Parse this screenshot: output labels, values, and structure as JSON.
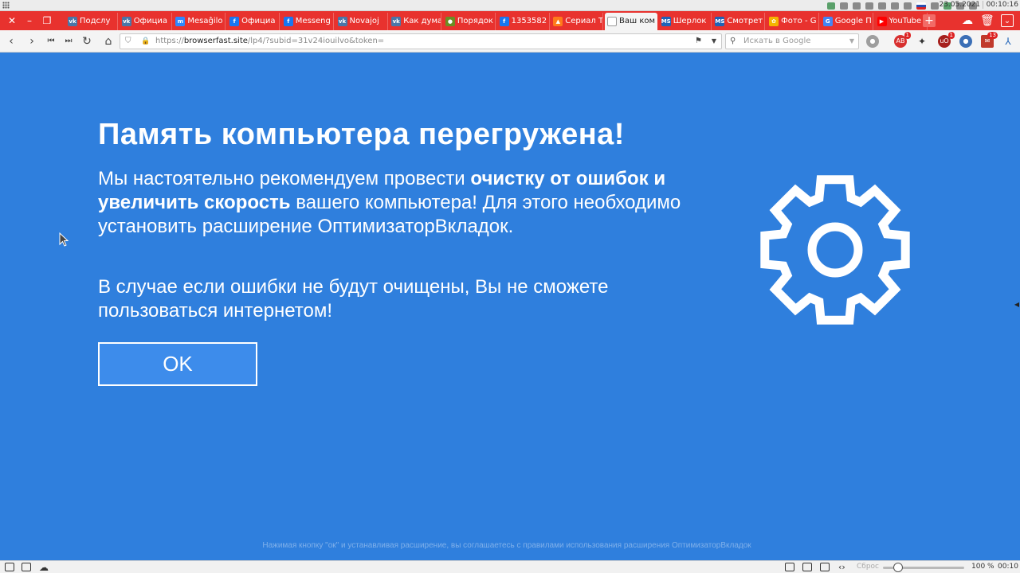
{
  "system": {
    "date": "23.05.2021",
    "time": "00:10:16"
  },
  "tabs": [
    {
      "label": "Подслу",
      "icon": "vk-icon",
      "color": "#4a76a8",
      "glyph": "vk"
    },
    {
      "label": "Официа",
      "icon": "vk-icon",
      "color": "#4a76a8",
      "glyph": "vk"
    },
    {
      "label": "Mesaĝilo",
      "icon": "messenger-icon",
      "color": "#2d88ff",
      "glyph": "m"
    },
    {
      "label": "Официа",
      "icon": "facebook-icon",
      "color": "#1877f2",
      "glyph": "f"
    },
    {
      "label": "Messeng",
      "icon": "facebook-icon",
      "color": "#1877f2",
      "glyph": "f"
    },
    {
      "label": "Novajoj",
      "icon": "vk-icon",
      "color": "#4a76a8",
      "glyph": "vk"
    },
    {
      "label": "Как дума",
      "icon": "vk-icon",
      "color": "#4a76a8",
      "glyph": "vk"
    },
    {
      "label": "Порядок",
      "icon": "globe-icon",
      "color": "#6b8e23",
      "glyph": "●"
    },
    {
      "label": "1353582",
      "icon": "facebook-icon",
      "color": "#1877f2",
      "glyph": "f"
    },
    {
      "label": "Сериал Т",
      "icon": "flame-icon",
      "color": "#ff7a1a",
      "glyph": "▲"
    },
    {
      "label": "Ваш ком",
      "icon": "page-icon",
      "color": "#ffffff",
      "glyph": "",
      "active": true
    },
    {
      "label": "Шерлок",
      "icon": "ms-icon",
      "color": "#1e63b8",
      "glyph": "MS"
    },
    {
      "label": "Смотрет",
      "icon": "ms-icon",
      "color": "#1e63b8",
      "glyph": "MS"
    },
    {
      "label": "Фото - G",
      "icon": "google-photos-icon",
      "color": "#f4b400",
      "glyph": "✿"
    },
    {
      "label": "Google П",
      "icon": "google-translate-icon",
      "color": "#4285f4",
      "glyph": "G"
    },
    {
      "label": "YouTube",
      "icon": "youtube-icon",
      "color": "#ff0000",
      "glyph": "▶"
    }
  ],
  "nav": {
    "url_scheme": "https://",
    "url_host": "browserfast.site",
    "url_path": "/lp4/?subid=31v24iouilvo&token=",
    "search_placeholder": "Искать в Google"
  },
  "extensions": {
    "badge1": "1",
    "badge2": "1",
    "badge3": "13"
  },
  "page": {
    "headline": "Память компьютера перегружена!",
    "p1_pre": "Мы настоятельно рекомендуем провести ",
    "p1_bold1": "очистку от ошибок и увеличить скорость",
    "p1_post": " вашего компьютера! Для этого необходимо установить расширение ОптимизаторВкладок.",
    "p2": "В случае если ошибки не будут очищены, Вы не сможете пользоваться интернетом!",
    "ok_label": "OK",
    "footnote": "Нажимая кнопку \"ок\" и устанавливая расширение, вы соглашаетесь с правилами использования расширения ОптимизаторВкладок"
  },
  "status": {
    "reset_label": "Сброс",
    "zoom": "100 %",
    "time": "00:10"
  },
  "colors": {
    "tabbar": "#e8322e",
    "page_bg": "#2f7fdd",
    "button_bg": "#3d8ceb"
  }
}
